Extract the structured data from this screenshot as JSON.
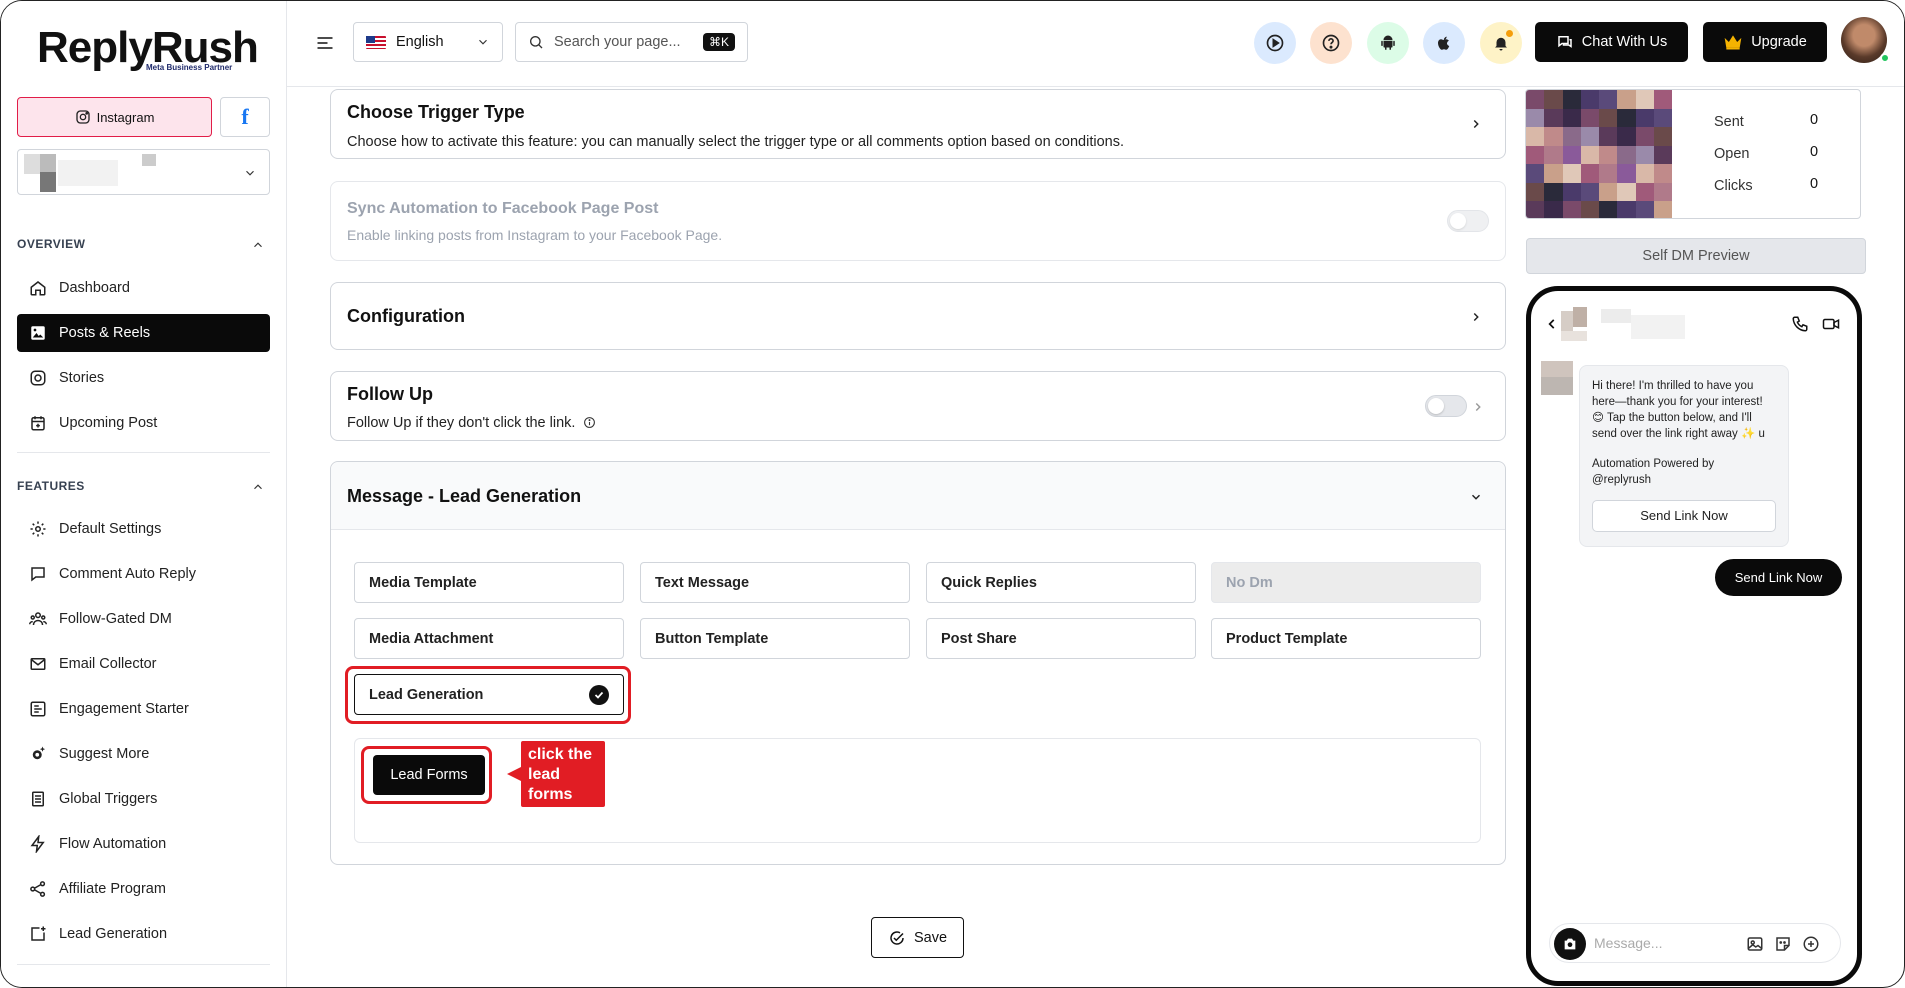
{
  "brand": {
    "name": "ReplyRush",
    "partner": "Meta Business Partner"
  },
  "sidebar": {
    "instagram_label": "Instagram",
    "facebook_label": "f",
    "overview_title": "OVERVIEW",
    "features_title": "FEATURES",
    "overview_items": [
      {
        "label": "Dashboard",
        "icon": "home-icon"
      },
      {
        "label": "Posts & Reels",
        "icon": "image-icon",
        "active": true
      },
      {
        "label": "Stories",
        "icon": "instagram-icon"
      },
      {
        "label": "Upcoming Post",
        "icon": "calendar-plus-icon"
      }
    ],
    "feature_items": [
      {
        "label": "Default Settings",
        "icon": "gear-icon"
      },
      {
        "label": "Comment Auto Reply",
        "icon": "comment-icon"
      },
      {
        "label": "Follow-Gated DM",
        "icon": "users-icon"
      },
      {
        "label": "Email Collector",
        "icon": "mail-icon"
      },
      {
        "label": "Engagement Starter",
        "icon": "edit-icon"
      },
      {
        "label": "Suggest More",
        "icon": "gear-sparkle-icon"
      },
      {
        "label": "Global Triggers",
        "icon": "book-icon"
      },
      {
        "label": "Flow Automation",
        "icon": "bolt-icon"
      },
      {
        "label": "Affiliate Program",
        "icon": "share-icon"
      },
      {
        "label": "Lead Generation",
        "icon": "plus-square-icon"
      }
    ]
  },
  "header": {
    "language": "English",
    "search_placeholder": "Search your page...",
    "shortcut": "⌘K",
    "chat_label": "Chat With Us",
    "upgrade_label": "Upgrade"
  },
  "main": {
    "trigger": {
      "title": "Choose Trigger Type",
      "desc": "Choose how to activate this feature: you can manually select the trigger type or all comments option based on conditions."
    },
    "sync": {
      "title": "Sync Automation to Facebook Page Post",
      "desc": "Enable linking posts from Instagram to your Facebook Page."
    },
    "configuration": {
      "title": "Configuration"
    },
    "followup": {
      "title": "Follow Up",
      "desc": "Follow Up if they don't click the link."
    },
    "message": {
      "title": "Message - Lead Generation"
    },
    "options": [
      "Media Template",
      "Text Message",
      "Quick Replies",
      "No Dm",
      "Media Attachment",
      "Button Template",
      "Post Share",
      "Product Template"
    ],
    "selected_option": "Lead Generation",
    "lead_forms_label": "Lead Forms",
    "callout": "click the lead forms",
    "save_label": "Save"
  },
  "preview": {
    "stats": [
      {
        "label": "Sent",
        "value": "0"
      },
      {
        "label": "Open",
        "value": "0"
      },
      {
        "label": "Clicks",
        "value": "0"
      }
    ],
    "self_dm_label": "Self DM Preview",
    "message_p1": "Hi there! I'm thrilled to have you here—thank you for your interest! 😊 Tap the button below, and I'll send over the link right away ✨ u",
    "message_p2": "Automation Powered by @replyrush",
    "send_link_label": "Send Link Now",
    "reply_label": "Send Link Now",
    "message_placeholder": "Message..."
  }
}
